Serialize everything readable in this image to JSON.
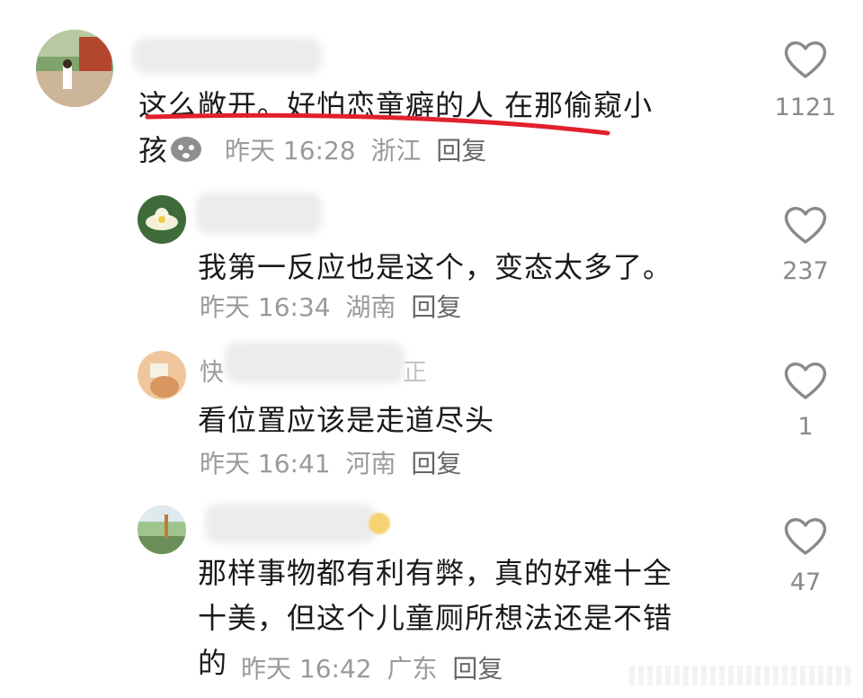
{
  "comments": [
    {
      "name": "",
      "text_line1": "这么敞开。好怕恋童癖的人 在那偷窥小",
      "text_line2": "孩",
      "time": "昨天 16:28",
      "location": "浙江",
      "reply": "回复",
      "likes": "1121"
    },
    {
      "name": "",
      "text": "我第一反应也是这个，变态太多了。",
      "time": "昨天 16:34",
      "location": "湖南",
      "reply": "回复",
      "likes": "237"
    },
    {
      "name": "快",
      "name_tail": "正",
      "text": "看位置应该是走道尽头",
      "time": "昨天 16:41",
      "location": "河南",
      "reply": "回复",
      "likes": "1"
    },
    {
      "name": "",
      "text_line1": "那样事物都有利有弊，真的好难十全",
      "text_line2": "十美，但这个儿童厕所想法还是不错",
      "text_line3": "的",
      "time": "昨天 16:42",
      "location": "广东",
      "reply": "回复",
      "likes": "47"
    }
  ],
  "colors": {
    "highlight": "#e0212d",
    "like": "#8a8a8a"
  }
}
